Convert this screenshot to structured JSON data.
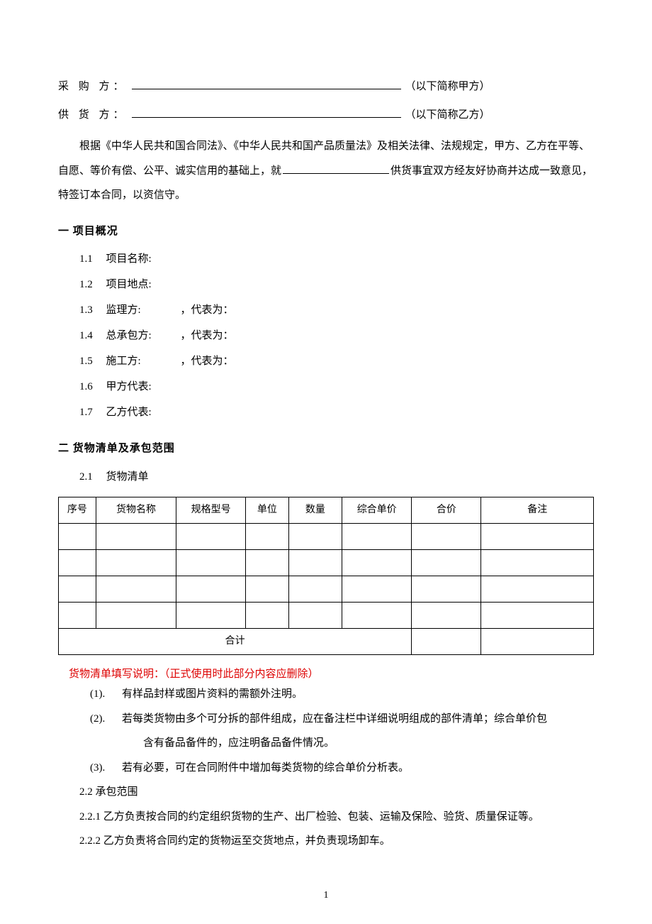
{
  "parties": {
    "buyer_label": "采 购 方：",
    "buyer_alias": "（以下简称甲方）",
    "supplier_label": "供 货 方：",
    "supplier_alias": "（以下简称乙方）"
  },
  "preamble": {
    "p1a": "根据《中华人民共和国合同法》、《中华人民共和国产品质量法》及相关法律、法规规定，甲方、乙方在平等、自愿、等价有偿、公平、诚实信用的基础上，就",
    "p1b": "供货事宜双方经友好协商并达成一致意见，特签订本合同，以资信守。"
  },
  "sec1": {
    "title": "一 项目概况",
    "items": [
      {
        "num": "1.1",
        "label": "项目名称:",
        "rep": ""
      },
      {
        "num": "1.2",
        "label": "项目地点:",
        "rep": ""
      },
      {
        "num": "1.3",
        "label": "监理方:",
        "rep": "，代表为："
      },
      {
        "num": "1.4",
        "label": "总承包方:",
        "rep": "，代表为："
      },
      {
        "num": "1.5",
        "label": "施工方:",
        "rep": "，代表为："
      },
      {
        "num": "1.6",
        "label": "甲方代表:",
        "rep": ""
      },
      {
        "num": "1.7",
        "label": "乙方代表:",
        "rep": ""
      }
    ]
  },
  "sec2": {
    "title": "二 货物清单及承包范围",
    "s21_num": "2.1",
    "s21_label": "货物清单",
    "table": {
      "headers": [
        "序号",
        "货物名称",
        "规格型号",
        "单位",
        "数量",
        "综合单价",
        "合价",
        "备注"
      ],
      "total_label": "合计"
    },
    "red_note": "货物清单填写说明：（正式使用时此部分内容应删除）",
    "instructions": [
      {
        "num": "(1).",
        "text": "有样品封样或图片资料的需额外注明。"
      },
      {
        "num": "(2).",
        "text": "若每类货物由多个可分拆的部件组成，应在备注栏中详细说明组成的部件清单；综合单价包",
        "cont": "含有备品备件的，应注明备品备件情况。"
      },
      {
        "num": "(3).",
        "text": "若有必要，可在合同附件中增加每类货物的综合单价分析表。"
      }
    ],
    "s22_num": "2.2",
    "s22_label": "承包范围",
    "s221": "2.2.1 乙方负责按合同的约定组织货物的生产、出厂检验、包装、运输及保险、验货、质量保证等。",
    "s222": "2.2.2 乙方负责将合同约定的货物运至交货地点，并负责现场卸车。"
  },
  "page_number": "1"
}
